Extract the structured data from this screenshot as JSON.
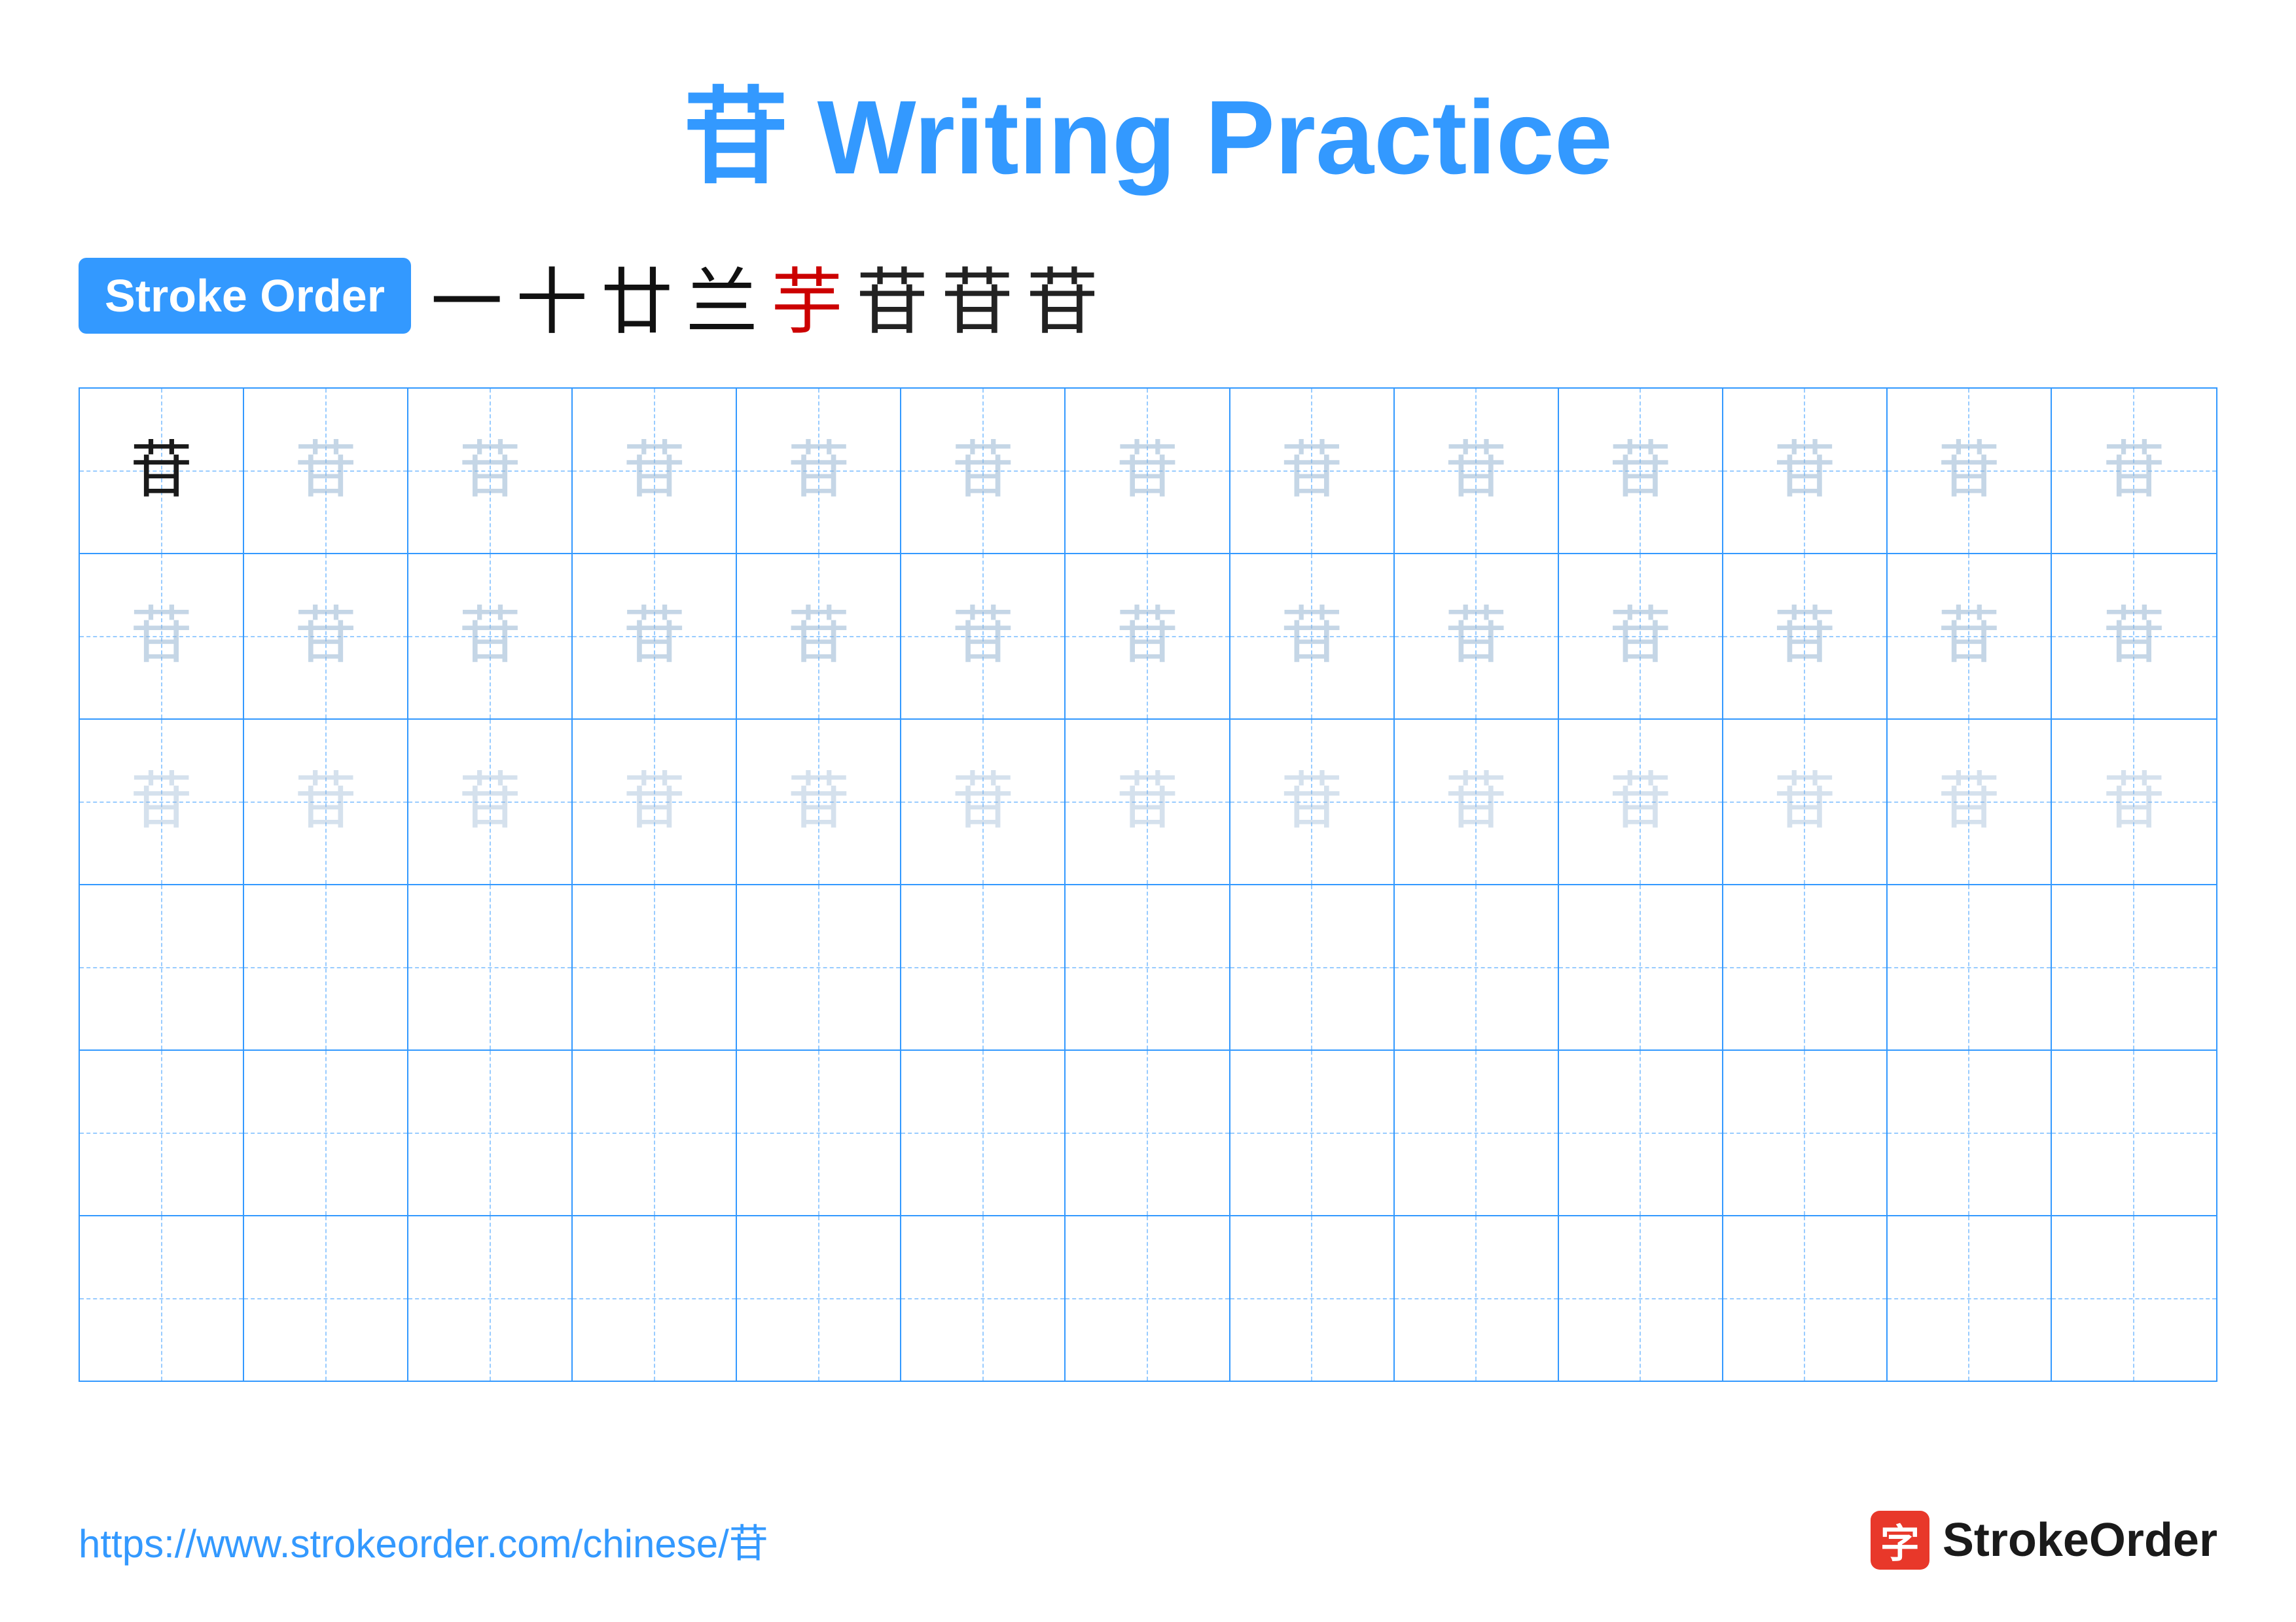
{
  "title": "苷 Writing Practice",
  "stroke_order_badge": "Stroke Order",
  "stroke_chars": [
    "一",
    "十",
    "廿",
    "兰",
    "芋",
    "苷",
    "苷",
    "苷"
  ],
  "stroke_colors": [
    "black",
    "black",
    "black",
    "black",
    "red",
    "black",
    "black",
    "black"
  ],
  "character": "苷",
  "rows": [
    {
      "type": "practice",
      "opacity_sequence": [
        "dark",
        "light1",
        "light1",
        "light1",
        "light1",
        "light1",
        "light1",
        "light1",
        "light1",
        "light1",
        "light1",
        "light1",
        "light1"
      ]
    },
    {
      "type": "practice",
      "opacity_sequence": [
        "light1",
        "light1",
        "light1",
        "light1",
        "light1",
        "light1",
        "light1",
        "light1",
        "light1",
        "light1",
        "light1",
        "light1",
        "light1"
      ]
    },
    {
      "type": "practice",
      "opacity_sequence": [
        "light2",
        "light2",
        "light2",
        "light2",
        "light2",
        "light2",
        "light2",
        "light2",
        "light2",
        "light2",
        "light2",
        "light2",
        "light2"
      ]
    },
    {
      "type": "empty"
    },
    {
      "type": "empty"
    },
    {
      "type": "empty"
    }
  ],
  "footer": {
    "url": "https://www.strokeorder.com/chinese/苷",
    "logo_icon": "字",
    "logo_text": "StrokeOrder"
  }
}
